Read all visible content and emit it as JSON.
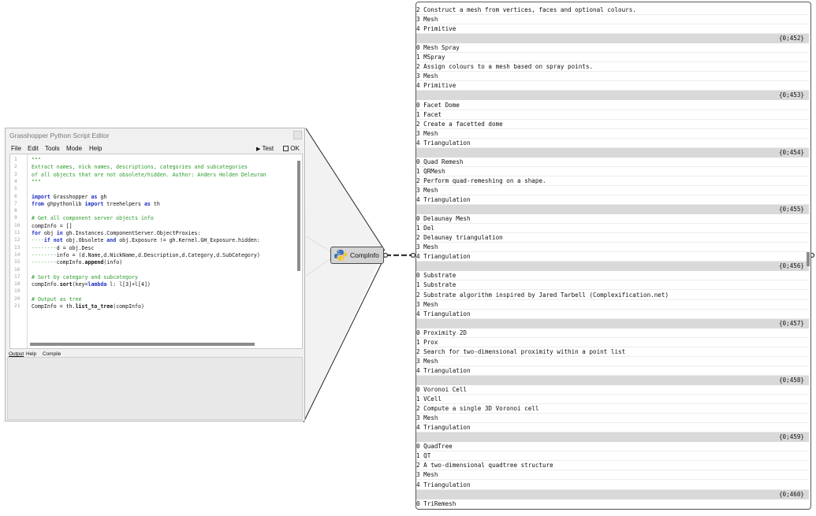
{
  "editor": {
    "title": "Grasshopper Python Script Editor",
    "menu": [
      "File",
      "Edit",
      "Tools",
      "Mode",
      "Help"
    ],
    "test_label": "Test",
    "ok_label": "OK",
    "output_tabs": [
      "Output",
      "Help",
      "Compile"
    ],
    "code_lines": [
      {
        "n": "1",
        "segs": [
          {
            "t": "\"\"\"",
            "c": "comment"
          }
        ]
      },
      {
        "n": "2",
        "segs": [
          {
            "t": "Extract names, nick names, descriptions, categories and subcategories",
            "c": "comment"
          }
        ]
      },
      {
        "n": "3",
        "segs": [
          {
            "t": "of all objects that are not obsolete/hidden. Author: Anders Holden Deleuran",
            "c": "comment"
          }
        ]
      },
      {
        "n": "4",
        "segs": [
          {
            "t": "\"\"\"",
            "c": "comment"
          }
        ]
      },
      {
        "n": "5",
        "segs": []
      },
      {
        "n": "6",
        "segs": [
          {
            "t": "import",
            "c": "kw"
          },
          {
            "t": " Grasshopper ",
            "c": ""
          },
          {
            "t": "as",
            "c": "kw"
          },
          {
            "t": " gh",
            "c": ""
          }
        ]
      },
      {
        "n": "7",
        "segs": [
          {
            "t": "from",
            "c": "kw"
          },
          {
            "t": " ghpythonlib ",
            "c": ""
          },
          {
            "t": "import",
            "c": "kw"
          },
          {
            "t": " treehelpers ",
            "c": ""
          },
          {
            "t": "as",
            "c": "kw"
          },
          {
            "t": " th",
            "c": ""
          }
        ]
      },
      {
        "n": "8",
        "segs": []
      },
      {
        "n": "9",
        "segs": [
          {
            "t": "# Get all component server objects info",
            "c": "comment"
          }
        ]
      },
      {
        "n": "10",
        "segs": [
          {
            "t": "compInfo = []",
            "c": ""
          }
        ]
      },
      {
        "n": "11",
        "segs": [
          {
            "t": "for",
            "c": "kw"
          },
          {
            "t": " obj ",
            "c": ""
          },
          {
            "t": "in",
            "c": "kw"
          },
          {
            "t": " gh.Instances.ComponentServer.ObjectProxies:",
            "c": ""
          }
        ]
      },
      {
        "n": "12",
        "segs": [
          {
            "t": "····",
            "c": "dot"
          },
          {
            "t": "if not",
            "c": "kw"
          },
          {
            "t": " obj.Obsolete ",
            "c": ""
          },
          {
            "t": "and",
            "c": "kw"
          },
          {
            "t": " obj.Exposure != gh.Kernel.GH_Exposure.hidden:",
            "c": ""
          }
        ]
      },
      {
        "n": "13",
        "segs": [
          {
            "t": "········",
            "c": "dot"
          },
          {
            "t": "d = obj.Desc",
            "c": ""
          }
        ]
      },
      {
        "n": "14",
        "segs": [
          {
            "t": "········",
            "c": "dot"
          },
          {
            "t": "info = (d.Name,d.NickName,d.Description,d.Category,d.SubCategory)",
            "c": ""
          }
        ]
      },
      {
        "n": "15",
        "segs": [
          {
            "t": "········",
            "c": "dot"
          },
          {
            "t": "compInfo.",
            "c": ""
          },
          {
            "t": "append",
            "c": "fn"
          },
          {
            "t": "(info)",
            "c": ""
          }
        ]
      },
      {
        "n": "16",
        "segs": []
      },
      {
        "n": "17",
        "segs": [
          {
            "t": "# Sort by category and subcategory",
            "c": "comment"
          }
        ]
      },
      {
        "n": "18",
        "segs": [
          {
            "t": "compInfo.",
            "c": ""
          },
          {
            "t": "sort",
            "c": "fn"
          },
          {
            "t": "(key=",
            "c": ""
          },
          {
            "t": "lambda",
            "c": "kw"
          },
          {
            "t": " l: l[3]+l[4])",
            "c": ""
          }
        ]
      },
      {
        "n": "19",
        "segs": []
      },
      {
        "n": "20",
        "segs": [
          {
            "t": "# Output as tree",
            "c": "comment"
          }
        ]
      },
      {
        "n": "21",
        "segs": [
          {
            "t": "CompInfo = th.",
            "c": ""
          },
          {
            "t": "list_to_tree",
            "c": "fn"
          },
          {
            "t": "(compInfo)",
            "c": ""
          }
        ]
      }
    ]
  },
  "component": {
    "label": "CompInfo",
    "icon": "python-icon"
  },
  "panel": {
    "rows": [
      {
        "k": "item",
        "t": "2 Construct a mesh from vertices, faces and optional colours."
      },
      {
        "k": "item",
        "t": "3 Mesh"
      },
      {
        "k": "item",
        "t": "4 Primitive"
      },
      {
        "k": "hdr",
        "t": "{0;452}"
      },
      {
        "k": "item",
        "t": "0 Mesh Spray"
      },
      {
        "k": "item",
        "t": "1 MSpray"
      },
      {
        "k": "item",
        "t": "2 Assign colours to a mesh based on spray points."
      },
      {
        "k": "item",
        "t": "3 Mesh"
      },
      {
        "k": "item",
        "t": "4 Primitive"
      },
      {
        "k": "hdr",
        "t": "{0;453}"
      },
      {
        "k": "item",
        "t": "0 Facet Dome"
      },
      {
        "k": "item",
        "t": "1 Facet"
      },
      {
        "k": "item",
        "t": "2 Create a facetted dome"
      },
      {
        "k": "item",
        "t": "3 Mesh"
      },
      {
        "k": "item",
        "t": "4 Triangulation"
      },
      {
        "k": "hdr",
        "t": "{0;454}"
      },
      {
        "k": "item",
        "t": "0 Quad Remesh"
      },
      {
        "k": "item",
        "t": "1 QRMesh"
      },
      {
        "k": "item",
        "t": "2 Perform quad-remeshing on a shape."
      },
      {
        "k": "item",
        "t": "3 Mesh"
      },
      {
        "k": "item",
        "t": "4 Triangulation"
      },
      {
        "k": "hdr",
        "t": "{0;455}"
      },
      {
        "k": "item",
        "t": "0 Delaunay Mesh"
      },
      {
        "k": "item",
        "t": "1 Del"
      },
      {
        "k": "item",
        "t": "2 Delaunay triangulation"
      },
      {
        "k": "item",
        "t": "3 Mesh"
      },
      {
        "k": "item",
        "t": "4 Triangulation"
      },
      {
        "k": "hdr",
        "t": "{0;456}"
      },
      {
        "k": "item",
        "t": "0 Substrate"
      },
      {
        "k": "item",
        "t": "1 Substrate"
      },
      {
        "k": "item",
        "t": "2 Substrate algorithm inspired by Jared Tarbell (Complexification.net)"
      },
      {
        "k": "item",
        "t": "3 Mesh"
      },
      {
        "k": "item",
        "t": "4 Triangulation"
      },
      {
        "k": "hdr",
        "t": "{0;457}"
      },
      {
        "k": "item",
        "t": "0 Proximity 2D"
      },
      {
        "k": "item",
        "t": "1 Prox"
      },
      {
        "k": "item",
        "t": "2 Search for two-dimensional proximity within a point list"
      },
      {
        "k": "item",
        "t": "3 Mesh"
      },
      {
        "k": "item",
        "t": "4 Triangulation"
      },
      {
        "k": "hdr",
        "t": "{0;458}"
      },
      {
        "k": "item",
        "t": "0 Voronoi Cell"
      },
      {
        "k": "item",
        "t": "1 VCell"
      },
      {
        "k": "item",
        "t": "2 Compute a single 3D Voronoi cell"
      },
      {
        "k": "item",
        "t": "3 Mesh"
      },
      {
        "k": "item",
        "t": "4 Triangulation"
      },
      {
        "k": "hdr",
        "t": "{0;459}"
      },
      {
        "k": "item",
        "t": "0 QuadTree"
      },
      {
        "k": "item",
        "t": "1 QT"
      },
      {
        "k": "item",
        "t": "2 A two-dimensional quadtree structure"
      },
      {
        "k": "item",
        "t": "3 Mesh"
      },
      {
        "k": "item",
        "t": "4 Triangulation"
      },
      {
        "k": "hdr",
        "t": "{0;460}"
      },
      {
        "k": "item",
        "t": "0 TriRemesh"
      }
    ]
  }
}
